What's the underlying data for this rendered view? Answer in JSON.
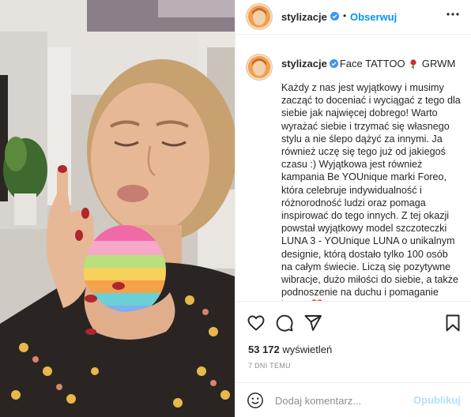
{
  "post": {
    "username": "stylizacje",
    "follow_label": "Obserwuj",
    "dot": "•",
    "caption_title": "Face TATTOO",
    "caption_title_suffix": "GRWM",
    "caption_body": "Każdy z nas jest wyjątkowy i musimy zacząć to doceniać i wyciągać z tego dla siebie jak najwięcej dobrego! Warto wyrażać siebie i trzymać się własnego stylu a nie ślepo dążyć za innymi. Ja również uczę się tego już od jakiegoś czasu :) Wyjątkowa jest również kampania Be YOUnique marki Foreo, która celebruje indywidualność i różnorodność ludzi oraz pomaga inspirować do tego innych. Z tej okazji powstał wyjątkowy model szczoteczki LUNA 3 - YOUnique LUNA o unikalnym designie, którą dostało tylko 100 osób na całym świecie. Liczą się pozytywne wibracje, dużo miłości do siebie, a także podnoszenie na duchu i pomaganie innym ❤️ FOREO ... FOR Every One!",
    "views_count": "53 172",
    "views_label": "wyświetleń",
    "time_ago": "7 DNI TEMU"
  },
  "comment": {
    "placeholder": "Dodaj komentarz...",
    "publish_label": "Opublikuj"
  },
  "icons": {
    "more": "more-horizontal-icon",
    "like": "heart-icon",
    "comment": "comment-bubble-icon",
    "share": "paper-plane-icon",
    "save": "bookmark-icon",
    "emoji": "smiley-icon",
    "verified": "verified-badge-icon",
    "rose": "rose-emoji-icon"
  },
  "colors": {
    "accent": "#0095f6",
    "verified": "#3897f0",
    "muted": "#8e8e8e",
    "publish_disabled": "#b2dffc",
    "border": "#efefef"
  }
}
